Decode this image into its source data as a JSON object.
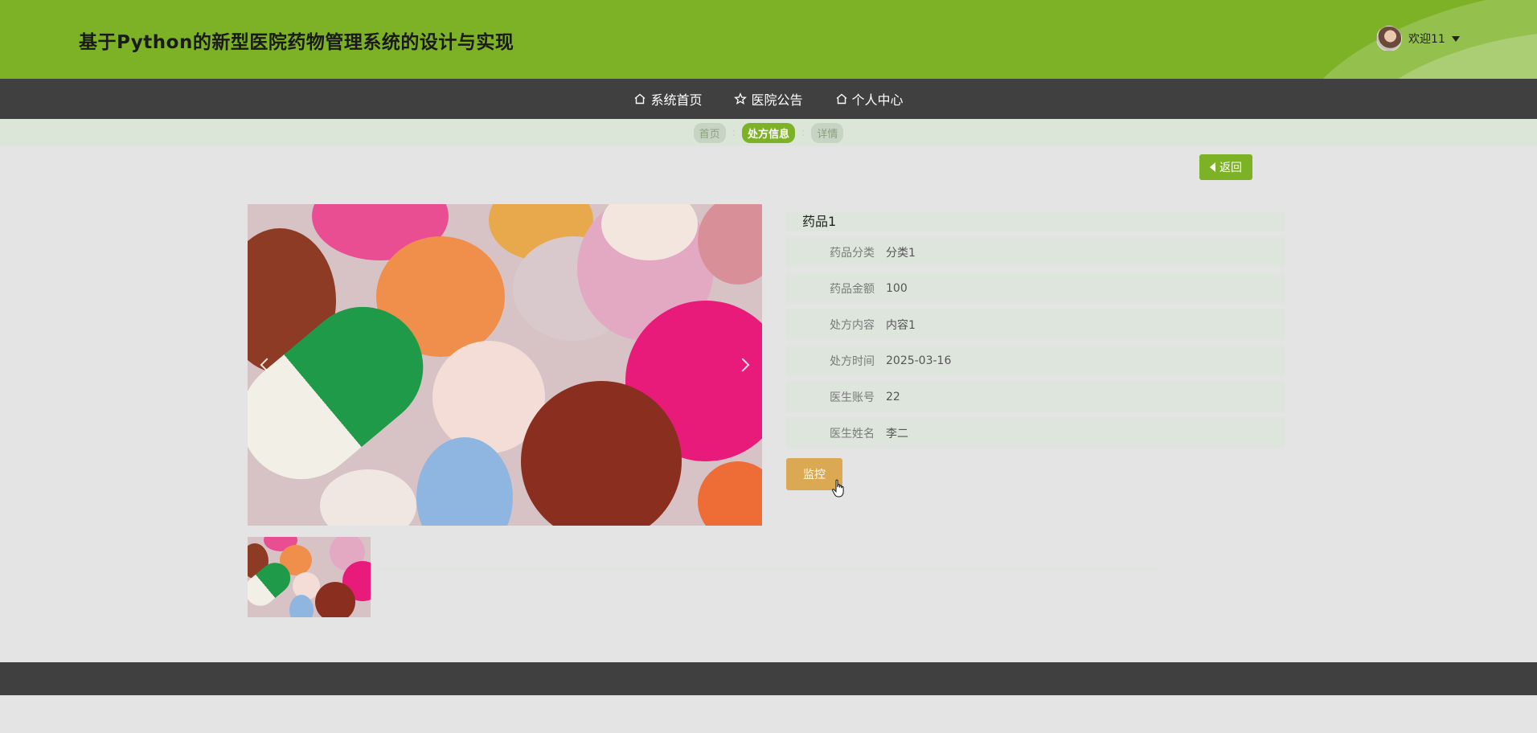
{
  "header": {
    "site_title": "基于Python的新型医院药物管理系统的设计与实现",
    "welcome_text": "欢迎11"
  },
  "nav": {
    "items": [
      {
        "label": "系统首页",
        "icon": "home-icon"
      },
      {
        "label": "医院公告",
        "icon": "star-icon"
      },
      {
        "label": "个人中心",
        "icon": "home-icon"
      }
    ]
  },
  "breadcrumb": {
    "items": [
      "首页",
      "处方信息",
      "详情"
    ],
    "active_index": 1
  },
  "actions": {
    "back_label": "返回",
    "monitor_label": "监控"
  },
  "detail": {
    "name": "药品1",
    "fields": [
      {
        "label": "药品分类",
        "value": "分类1"
      },
      {
        "label": "药品金额",
        "value": "100"
      },
      {
        "label": "处方内容",
        "value": "内容1"
      },
      {
        "label": "处方时间",
        "value": "2025-03-16"
      },
      {
        "label": "医生账号",
        "value": "22"
      },
      {
        "label": "医生姓名",
        "value": "李二"
      }
    ]
  },
  "colors": {
    "brand_green": "#7db226",
    "dark_bar": "#404040",
    "monitor_gold": "#dba954"
  }
}
